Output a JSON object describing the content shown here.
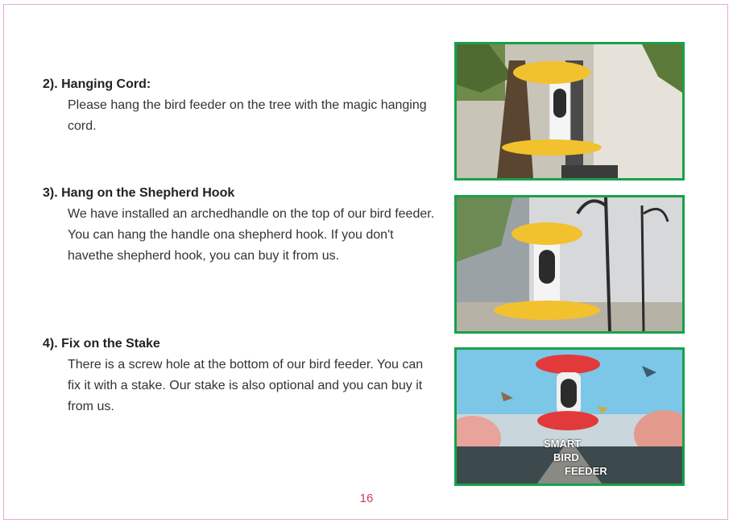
{
  "sections": [
    {
      "heading": "2). Hanging Cord:",
      "body": "Please hang the bird feeder on the tree with the magic hanging cord."
    },
    {
      "heading": "3). Hang on the Shepherd Hook",
      "body": "We have installed an archedhandle on the top of our bird feeder. You can hang the handle ona shepherd hook. If you don't havethe shepherd hook, you can buy it from us."
    },
    {
      "heading": "4). Fix on the Stake",
      "body": "There is a screw hole at the bottom of our bird feeder. You can fix it with a stake. Our stake is also optional and you can buy it from us."
    }
  ],
  "photos": [
    {
      "icon": "bird-feeder-on-tree-photo"
    },
    {
      "icon": "bird-feeder-on-shepherd-hook-photo"
    },
    {
      "icon": "smart-bird-feeder-poster-photo",
      "poster_text": [
        "SMART",
        "BIRD",
        "FEEDER"
      ]
    }
  ],
  "page_number": "16",
  "colors": {
    "frame_border": "#e7a9d6",
    "photo_border": "#18a14a",
    "page_number": "#d23b52",
    "feeder_yellow": "#f2c12e"
  }
}
